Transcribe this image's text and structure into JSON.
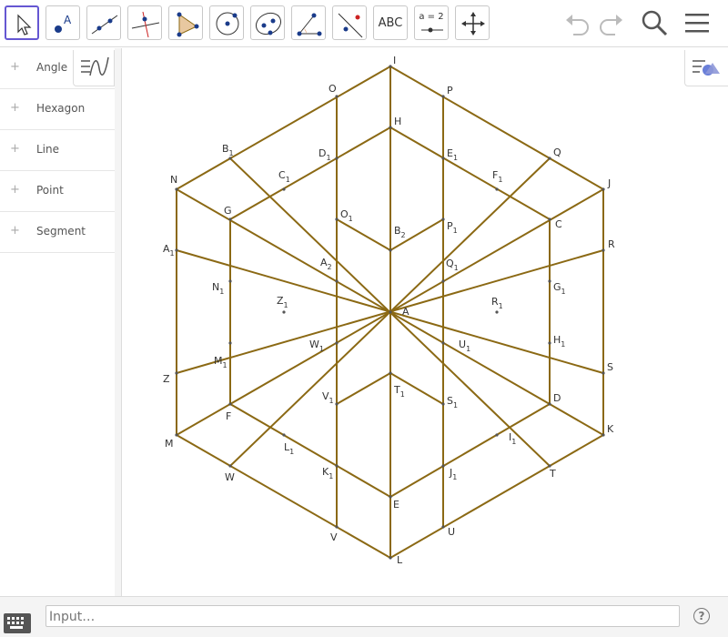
{
  "toolbar": {
    "tools": [
      {
        "name": "move-tool",
        "icon": "cursor-arrow-icon"
      },
      {
        "name": "point-tool",
        "icon": "point-icon"
      },
      {
        "name": "line-tool",
        "icon": "line-through-points-icon"
      },
      {
        "name": "perpendicular-line-tool",
        "icon": "perpendicular-line-icon"
      },
      {
        "name": "polygon-tool",
        "icon": "polygon-icon"
      },
      {
        "name": "circle-tool",
        "icon": "circle-with-center-icon"
      },
      {
        "name": "ellipse-tool",
        "icon": "ellipse-icon"
      },
      {
        "name": "angle-tool",
        "icon": "angle-icon"
      },
      {
        "name": "reflect-tool",
        "icon": "reflect-about-line-icon"
      },
      {
        "name": "text-tool",
        "label": "ABC"
      },
      {
        "name": "slider-tool",
        "label": "a = 2"
      },
      {
        "name": "move-graphics-tool",
        "icon": "move-arrows-icon"
      }
    ],
    "undo_icon": "undo-icon",
    "redo_icon": "redo-icon",
    "search_icon": "search-icon",
    "menu_icon": "hamburger-menu-icon"
  },
  "algebra": {
    "categories": [
      "Angle",
      "Hexagon",
      "Line",
      "Point",
      "Segment"
    ]
  },
  "input": {
    "placeholder": "Input…"
  },
  "colors": {
    "segment": "#8b6914",
    "active_tool_border": "#6557d2"
  },
  "points": {
    "I": {
      "label": "I",
      "sub": ""
    },
    "P": {
      "label": "P",
      "sub": ""
    },
    "O": {
      "label": "O",
      "sub": ""
    },
    "H": {
      "label": "H",
      "sub": ""
    },
    "Q": {
      "label": "Q",
      "sub": ""
    },
    "J": {
      "label": "J",
      "sub": ""
    },
    "B1": {
      "label": "B",
      "sub": "1"
    },
    "D1": {
      "label": "D",
      "sub": "1"
    },
    "E1": {
      "label": "E",
      "sub": "1"
    },
    "F1": {
      "label": "F",
      "sub": "1"
    },
    "C1": {
      "label": "C",
      "sub": "1"
    },
    "N": {
      "label": "N",
      "sub": ""
    },
    "G": {
      "label": "G",
      "sub": ""
    },
    "O1": {
      "label": "O",
      "sub": "1"
    },
    "B2": {
      "label": "B",
      "sub": "2"
    },
    "P1": {
      "label": "P",
      "sub": "1"
    },
    "C": {
      "label": "C",
      "sub": ""
    },
    "R": {
      "label": "R",
      "sub": ""
    },
    "A1": {
      "label": "A",
      "sub": "1"
    },
    "A2": {
      "label": "A",
      "sub": "2"
    },
    "Q1": {
      "label": "Q",
      "sub": "1"
    },
    "G1": {
      "label": "G",
      "sub": "1"
    },
    "N1": {
      "label": "N",
      "sub": "1"
    },
    "Z1": {
      "label": "Z",
      "sub": "1"
    },
    "R1": {
      "label": "R",
      "sub": "1"
    },
    "A": {
      "label": "A",
      "sub": ""
    },
    "W1": {
      "label": "W",
      "sub": "1"
    },
    "U1": {
      "label": "U",
      "sub": "1"
    },
    "H1": {
      "label": "H",
      "sub": "1"
    },
    "M1": {
      "label": "M",
      "sub": "1"
    },
    "Z": {
      "label": "Z",
      "sub": ""
    },
    "S": {
      "label": "S",
      "sub": ""
    },
    "V1": {
      "label": "V",
      "sub": "1"
    },
    "T1": {
      "label": "T",
      "sub": "1"
    },
    "S1": {
      "label": "S",
      "sub": "1"
    },
    "D": {
      "label": "D",
      "sub": ""
    },
    "F": {
      "label": "F",
      "sub": ""
    },
    "K": {
      "label": "K",
      "sub": ""
    },
    "I1": {
      "label": "I",
      "sub": "1"
    },
    "M": {
      "label": "M",
      "sub": ""
    },
    "L1": {
      "label": "L",
      "sub": "1"
    },
    "W": {
      "label": "W",
      "sub": ""
    },
    "K1": {
      "label": "K",
      "sub": "1"
    },
    "J1": {
      "label": "J",
      "sub": "1"
    },
    "T": {
      "label": "T",
      "sub": ""
    },
    "E": {
      "label": "E",
      "sub": ""
    },
    "U": {
      "label": "U",
      "sub": ""
    },
    "V": {
      "label": "V",
      "sub": ""
    },
    "L": {
      "label": "L",
      "sub": ""
    }
  }
}
